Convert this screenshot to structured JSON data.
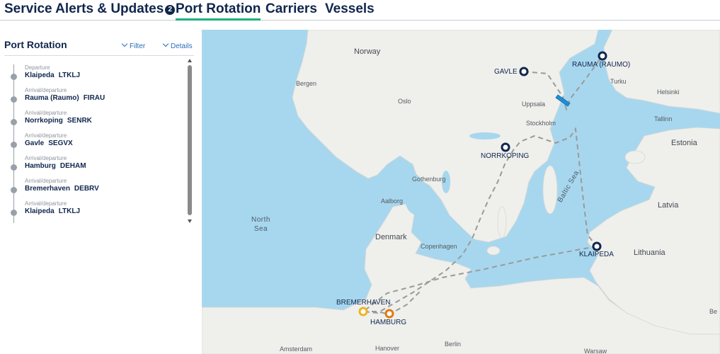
{
  "tabs": [
    {
      "label": "Service Alerts & Updates",
      "badge": "2"
    },
    {
      "label": "Port Rotation"
    },
    {
      "label": "Carriers"
    },
    {
      "label": "Vessels"
    }
  ],
  "panel": {
    "title": "Port Rotation",
    "filter_label": "Filter",
    "details_label": "Details",
    "stops": [
      {
        "type": "Departure",
        "name": "Klaipeda",
        "code": "LTKLJ"
      },
      {
        "type": "Arrival/departure",
        "name": "Rauma (Raumo)",
        "code": "FIRAU"
      },
      {
        "type": "Arrival/departure",
        "name": "Norrkoping",
        "code": "SENRK"
      },
      {
        "type": "Arrival/departure",
        "name": "Gavle",
        "code": "SEGVX"
      },
      {
        "type": "Arrival/departure",
        "name": "Hamburg",
        "code": "DEHAM"
      },
      {
        "type": "Arrival/departure",
        "name": "Bremerhaven",
        "code": "DEBRV"
      },
      {
        "type": "Arrival/departure",
        "name": "Klaipeda",
        "code": "LTKLJ"
      }
    ]
  },
  "map": {
    "ports": {
      "gavle": "GAVLE",
      "rauma": "RAUMA (RAUMO)",
      "norrkoping": "NORRKOPING",
      "klaipeda": "KLAIPEDA",
      "bremerhaven": "BREMERHAVEN",
      "hamburg": "HAMBURG"
    },
    "labels": {
      "norway": "Norway",
      "bergen": "Bergen",
      "oslo": "Oslo",
      "uppsala": "Uppsala",
      "stockholm": "Stockholm",
      "turku": "Turku",
      "helsinki": "Helsinki",
      "tallinn": "Tallinn",
      "estonia": "Estonia",
      "latvia": "Latvia",
      "lithuania": "Lithuania",
      "gothenburg": "Gothenburg",
      "aalborg": "Aalborg",
      "denmark": "Denmark",
      "copenhagen": "Copenhagen",
      "north_sea_1": "North",
      "north_sea_2": "Sea",
      "baltic_sea": "Baltic Sea",
      "berlin": "Berlin",
      "hanover": "Hanover",
      "amsterdam": "Amsterdam",
      "warsaw": "Warsaw",
      "be": "Be"
    },
    "colors": {
      "water": "#a7d7ee",
      "land": "#efefec",
      "port_marker": "#10264d",
      "bremerhaven_marker": "#f0b321",
      "hamburg_marker": "#e07a12",
      "route": "#9a9a9a",
      "vessel": "#1f8fd6"
    }
  }
}
